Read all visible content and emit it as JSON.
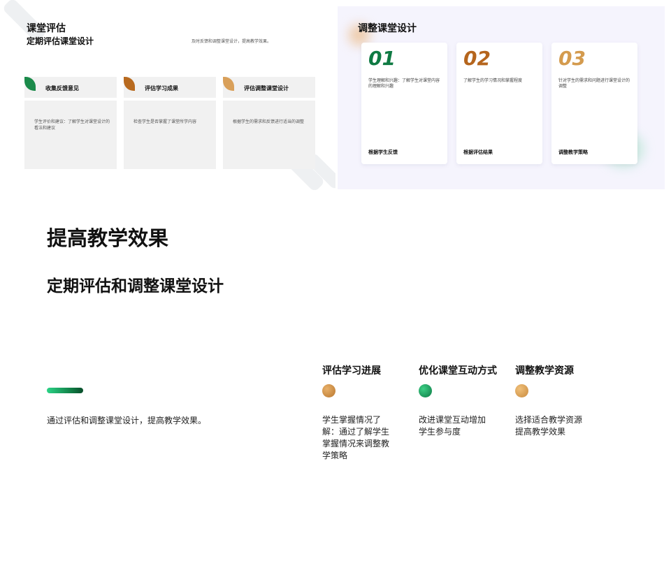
{
  "slide_left": {
    "title": "课堂评估",
    "subtitle": "定期评估课堂设计",
    "description": "及时反馈和调整课堂设计，提高教学效果。",
    "cards": [
      {
        "label": "收集反馈意见",
        "text": "学生评价和建议：了解学生对课堂设计的看法和建议",
        "color": "#1b8a4a"
      },
      {
        "label": "评估学习成果",
        "text": "检查学生是否掌握了课堂所学内容",
        "color": "#b86a1f"
      },
      {
        "label": "评估调整课堂设计",
        "text": "根据学生的需求和反馈进行适当的调整",
        "color": "#d9a05a"
      }
    ]
  },
  "slide_right": {
    "title": "调整课堂设计",
    "cards": [
      {
        "number": "01",
        "text": "学生理解和兴趣：了解学生对课堂内容的理解和兴趣",
        "footer": "根据学生反馈",
        "color": "#0f7a43"
      },
      {
        "number": "02",
        "text": "了解学生的学习情况和掌握程度",
        "footer": "根据评估结果",
        "color": "#b5651d"
      },
      {
        "number": "03",
        "text": "针对学生的需求和问题进行课堂设计的调整",
        "footer": "调整教学策略",
        "color": "#d49b4e"
      }
    ]
  },
  "main": {
    "title": "提高教学效果",
    "subtitle": "定期评估和调整课堂设计",
    "summary": "通过评估和调整课堂设计，提高教学效果。",
    "columns": [
      {
        "heading": "评估学习进展",
        "body": "学生掌握情况了解：通过了解学生掌握情况来调整教学策略",
        "dot_color": "#c98a3e"
      },
      {
        "heading": "优化课堂互动方式",
        "body": "改进课堂互动增加学生参与度",
        "dot_color": "#14935a"
      },
      {
        "heading": "调整教学资源",
        "body": "选择适合教学资源提高教学效果",
        "dot_color": "#d9a05a"
      }
    ]
  }
}
